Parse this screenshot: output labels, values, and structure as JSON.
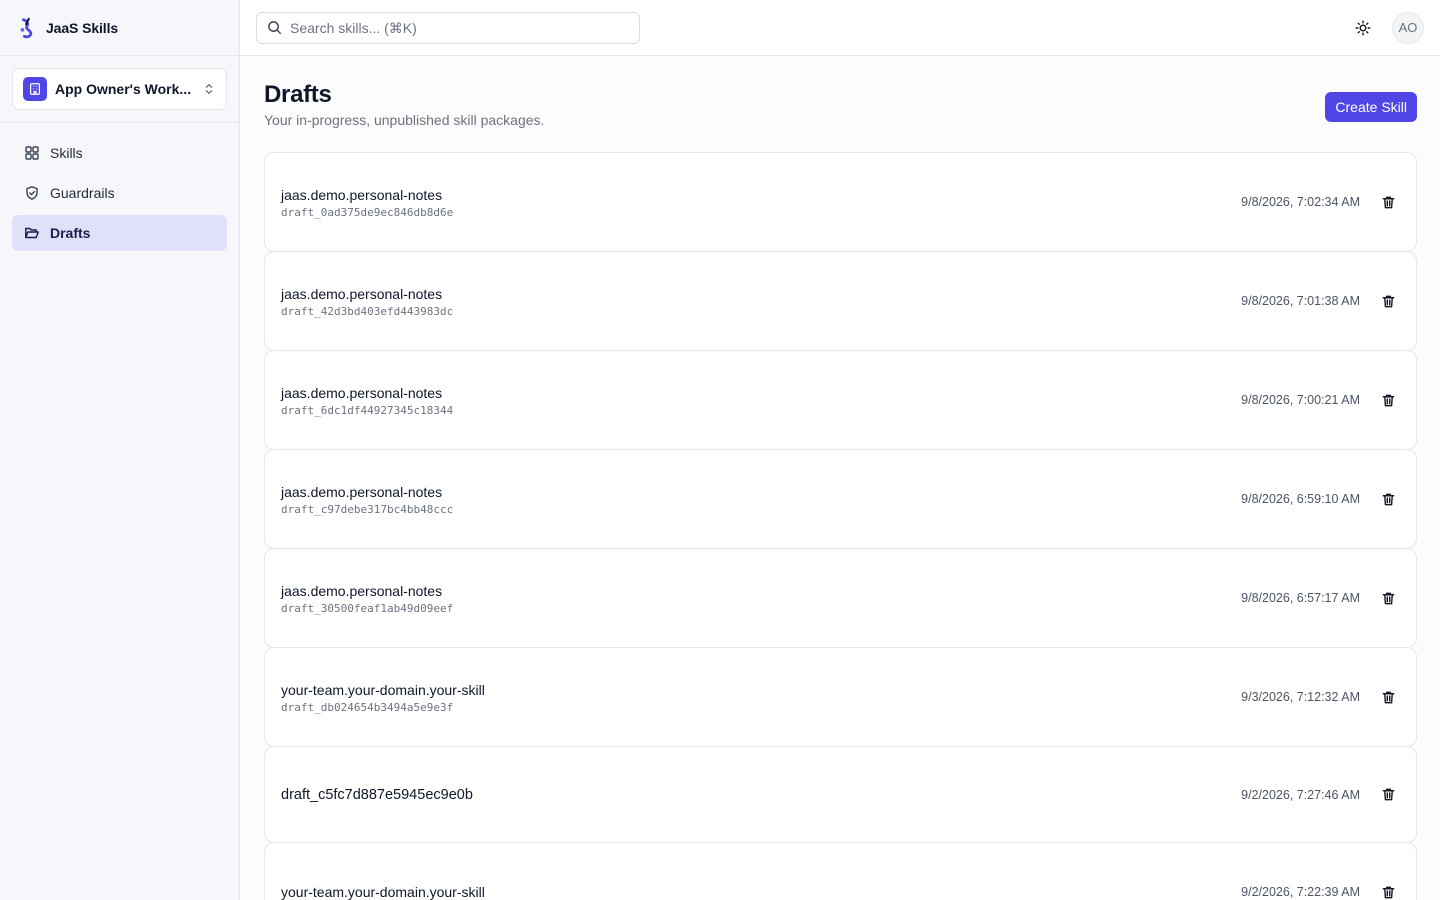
{
  "brand": {
    "name": "JaaS Skills",
    "accent": "#4f46e5"
  },
  "workspace": {
    "name": "App Owner's Work..."
  },
  "nav": {
    "items": [
      {
        "label": "Skills",
        "icon": "grid-icon"
      },
      {
        "label": "Guardrails",
        "icon": "shield-check-icon"
      },
      {
        "label": "Drafts",
        "icon": "folder-open-icon",
        "active": true
      }
    ]
  },
  "search": {
    "placeholder": "Search skills... (⌘K)",
    "value": ""
  },
  "user": {
    "initials": "AO"
  },
  "page": {
    "title": "Drafts",
    "subtitle": "Your in-progress, unpublished skill packages.",
    "create_label": "Create Skill"
  },
  "drafts": [
    {
      "name": "jaas.demo.personal-notes",
      "id": "draft_0ad375de9ec846db8d6e",
      "date": "9/8/2026, 7:02:34 AM"
    },
    {
      "name": "jaas.demo.personal-notes",
      "id": "draft_42d3bd403efd443983dc",
      "date": "9/8/2026, 7:01:38 AM"
    },
    {
      "name": "jaas.demo.personal-notes",
      "id": "draft_6dc1df44927345c18344",
      "date": "9/8/2026, 7:00:21 AM"
    },
    {
      "name": "jaas.demo.personal-notes",
      "id": "draft_c97debe317bc4bb48ccc",
      "date": "9/8/2026, 6:59:10 AM"
    },
    {
      "name": "jaas.demo.personal-notes",
      "id": "draft_30500feaf1ab49d09eef",
      "date": "9/8/2026, 6:57:17 AM"
    },
    {
      "name": "your-team.your-domain.your-skill",
      "id": "draft_db024654b3494a5e9e3f",
      "date": "9/3/2026, 7:12:32 AM"
    },
    {
      "name": "draft_c5fc7d887e5945ec9e0b",
      "id": "",
      "date": "9/2/2026, 7:27:46 AM"
    },
    {
      "name": "your-team.your-domain.your-skill",
      "id": "",
      "date": "9/2/2026, 7:22:39 AM"
    }
  ]
}
